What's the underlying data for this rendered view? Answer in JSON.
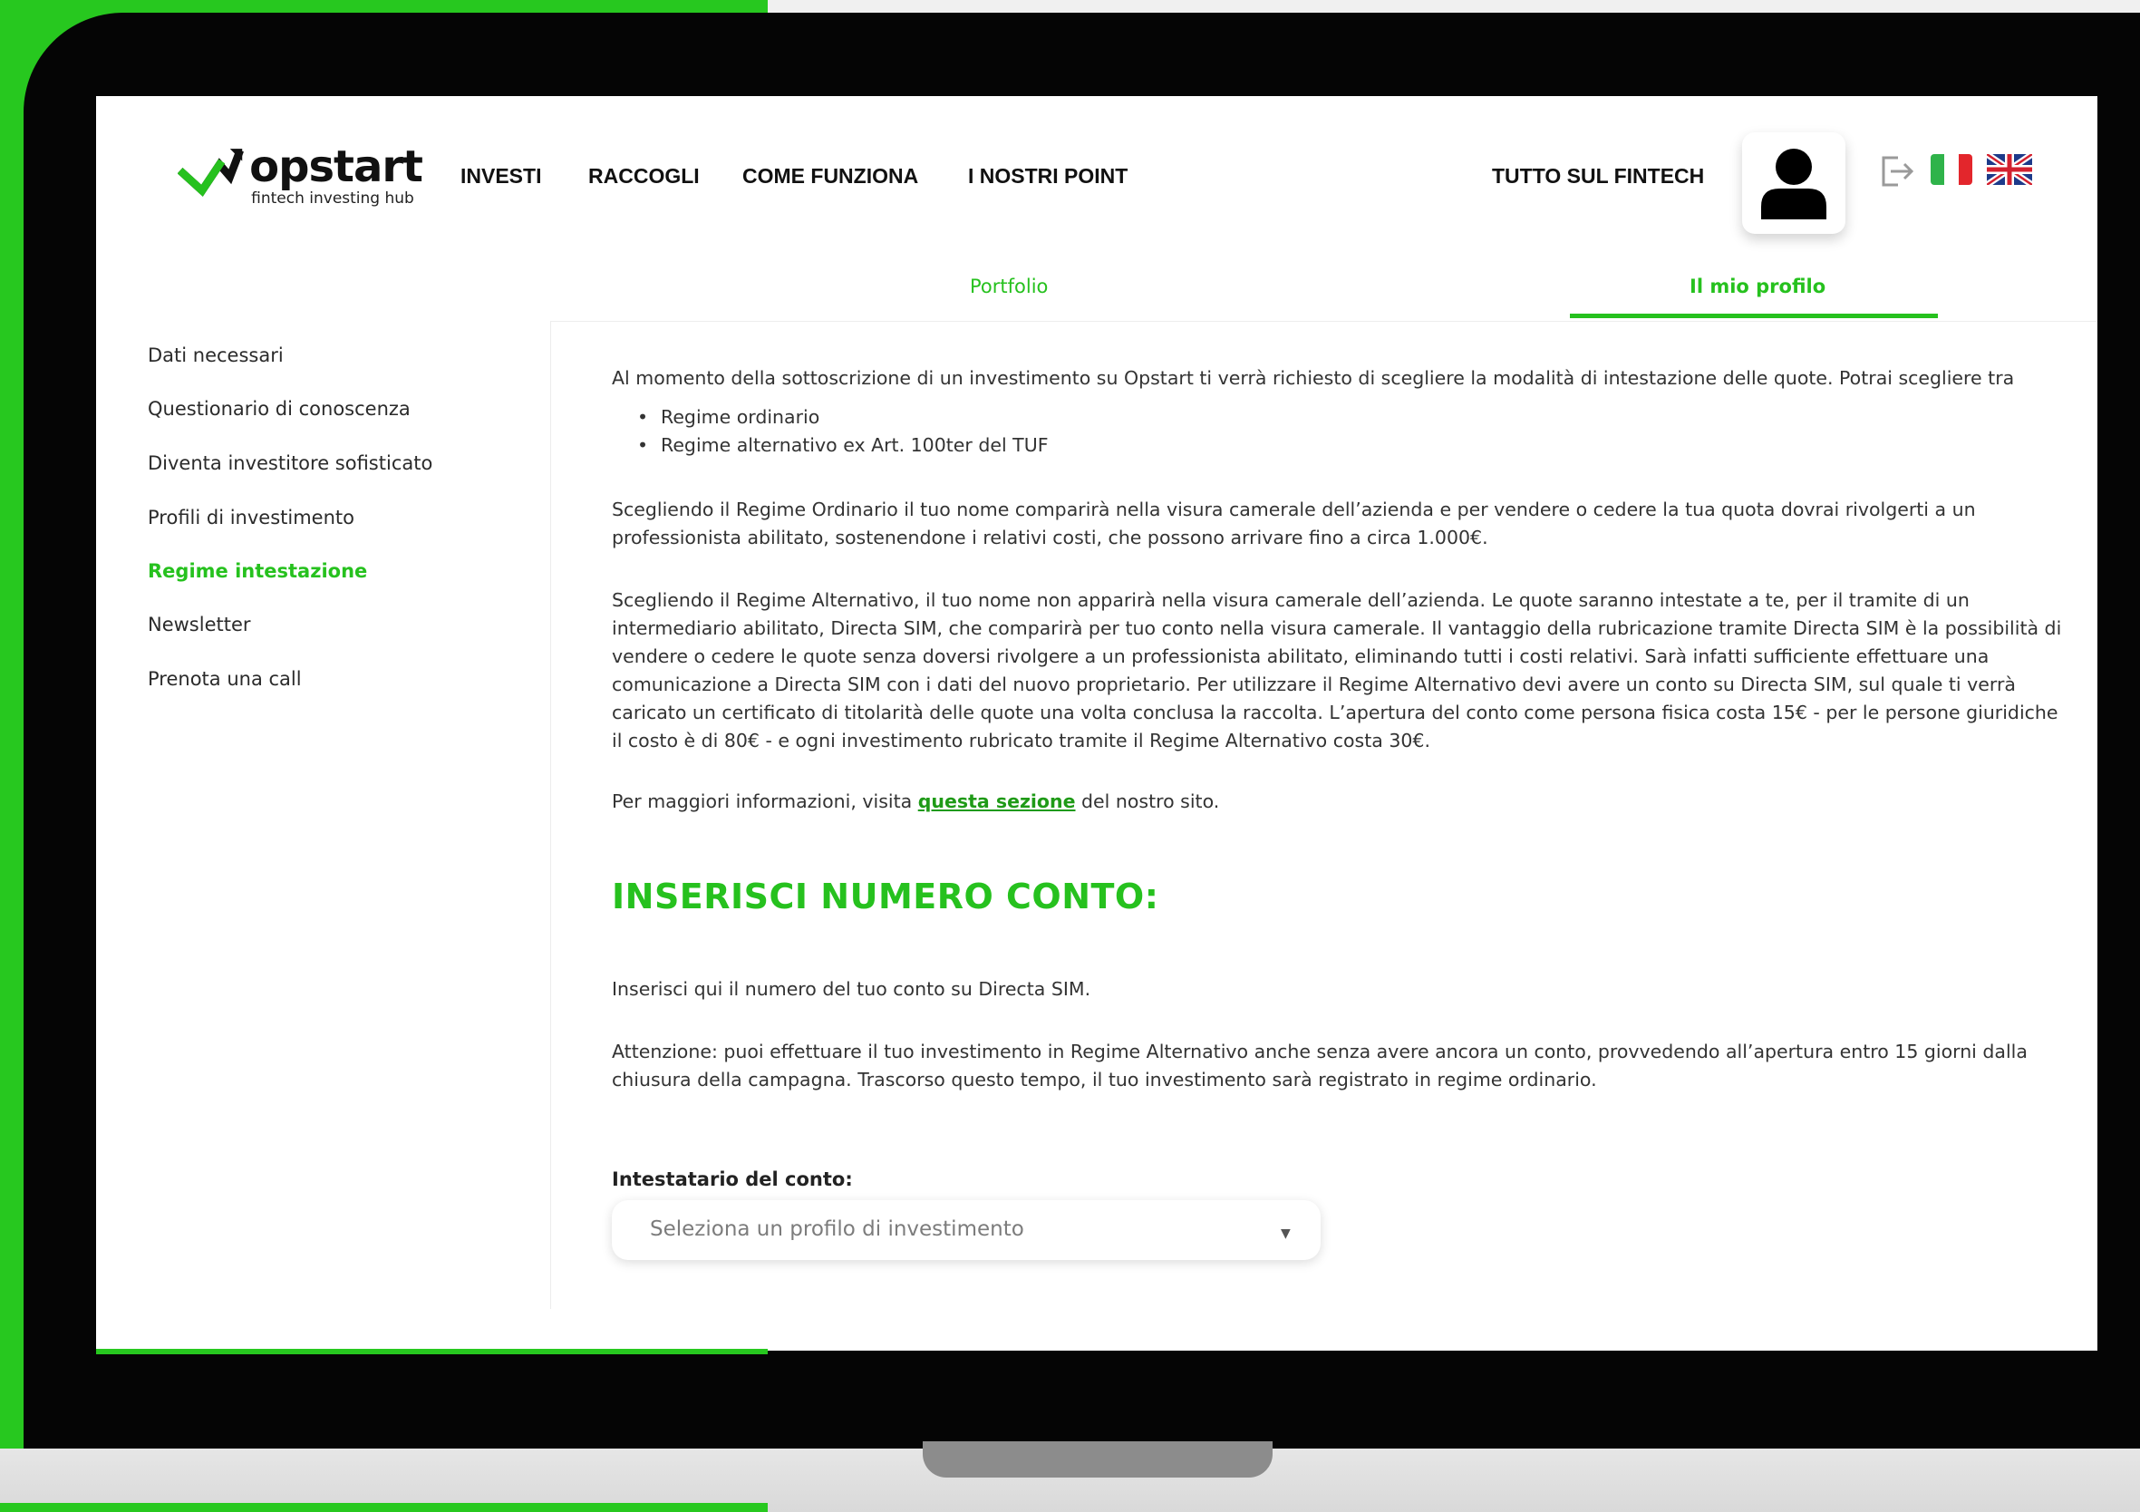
{
  "header": {
    "logo": {
      "word": "opstart",
      "tagline": "fintech investing hub"
    },
    "nav": [
      "INVESTI",
      "RACCOGLI",
      "COME FUNZIONA",
      "I NOSTRI POINT"
    ],
    "nav_right": "TUTTO SUL FINTECH"
  },
  "tabs": [
    {
      "label": "Portfolio",
      "active": false
    },
    {
      "label": "Il mio profilo",
      "active": true
    }
  ],
  "sidebar": {
    "items": [
      {
        "label": "Dati necessari",
        "active": false
      },
      {
        "label": "Questionario di conoscenza",
        "active": false
      },
      {
        "label": "Diventa investitore sofisticato",
        "active": false
      },
      {
        "label": "Profili di investimento",
        "active": false
      },
      {
        "label": "Regime intestazione",
        "active": true
      },
      {
        "label": "Newsletter",
        "active": false
      },
      {
        "label": "Prenota una call",
        "active": false
      }
    ]
  },
  "main": {
    "intro": "Al momento della sottoscrizione di un investimento su Opstart ti verrà richiesto di scegliere la modalità di intestazione delle quote. Potrai scegliere tra",
    "bullets": [
      "Regime ordinario",
      "Regime alternativo ex Art. 100ter del TUF"
    ],
    "para_ordinario": "Scegliendo il Regime Ordinario il tuo nome comparirà nella visura camerale dell’azienda e per vendere o cedere la tua quota dovrai rivolgerti a un professionista abilitato, sostenendone i relativi costi, che possono arrivare fino a circa 1.000€.",
    "para_alternativo": "Scegliendo il Regime Alternativo, il tuo nome non apparirà nella visura camerale dell’azienda. Le quote saranno intestate a te, per il tramite di un intermediario abilitato, Directa SIM, che comparirà per tuo conto nella visura camerale. Il vantaggio della rubricazione tramite Directa SIM è la possibilità di vendere o cedere le quote senza doversi rivolgere a un professionista abilitato, eliminando tutti i costi relativi. Sarà infatti sufficiente effettuare una comunicazione a Directa SIM con i dati del nuovo proprietario. Per utilizzare il Regime Alternativo devi avere un conto su Directa SIM, sul quale ti verrà caricato un certificato di titolarità delle quote una volta conclusa la raccolta. L’apertura del conto come persona fisica costa 15€ - per le persone giuridiche il costo è di 80€ - e ogni investimento rubricato tramite il Regime Alternativo costa 30€.",
    "info_before": "Per maggiori informazioni, visita ",
    "info_link": "questa sezione",
    "info_after": " del nostro sito.",
    "heading": "INSERISCI NUMERO CONTO:",
    "instruction": "Inserisci qui il numero del tuo conto su Directa SIM.",
    "warning": "Attenzione: puoi effettuare il tuo investimento in Regime Alternativo anche senza avere ancora un conto, provvedendo all’apertura entro 15 giorni dalla chiusura della campagna. Trascorso questo tempo, il tuo investimento sarà registrato in regime ordinario.",
    "field_label": "Intestatario del conto:",
    "select_placeholder": "Seleziona un profilo di investimento"
  },
  "icons": {
    "logo": "opstart-logo-icon",
    "avatar": "user-icon",
    "logout": "logout-icon",
    "flag_it": "flag-italy-icon",
    "flag_uk": "flag-uk-icon",
    "caret": "caret-down-icon"
  },
  "colors": {
    "brand_green": "#26c11e",
    "frame_green": "#27c81f",
    "text": "#333333"
  }
}
